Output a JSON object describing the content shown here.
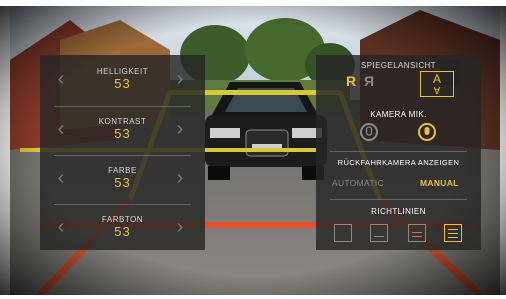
{
  "left_panel": {
    "rows": [
      {
        "label": "HELLIGKEIT",
        "value": "53"
      },
      {
        "label": "KONTRAST",
        "value": "53"
      },
      {
        "label": "FARBE",
        "value": "53"
      },
      {
        "label": "FARBTON",
        "value": "53"
      }
    ],
    "arrow_left": "‹",
    "arrow_right": "›"
  },
  "right_panel": {
    "mirror_view_title": "SPIEGELANSICHT",
    "mirror_options": [
      {
        "glyph": "R",
        "state": "selected"
      },
      {
        "glyph": "Я",
        "state": "inactive"
      },
      {
        "glyph": "A",
        "state": "selected"
      }
    ],
    "camera_mic_title": "KAMERA MIK.",
    "rear_camera_title": "RÜCKFAHRKAMERA ANZEIGEN",
    "mode_automatic": "AUTOMATIC",
    "mode_manual": "MANUAL",
    "guidelines_title": "RICHTLINIEN"
  },
  "colors": {
    "accent": "#e8c040",
    "inactive": "#8a8a8a",
    "label": "#d8d8d8",
    "guide_red": "#e0522a",
    "guide_yellow": "#d8c838"
  }
}
